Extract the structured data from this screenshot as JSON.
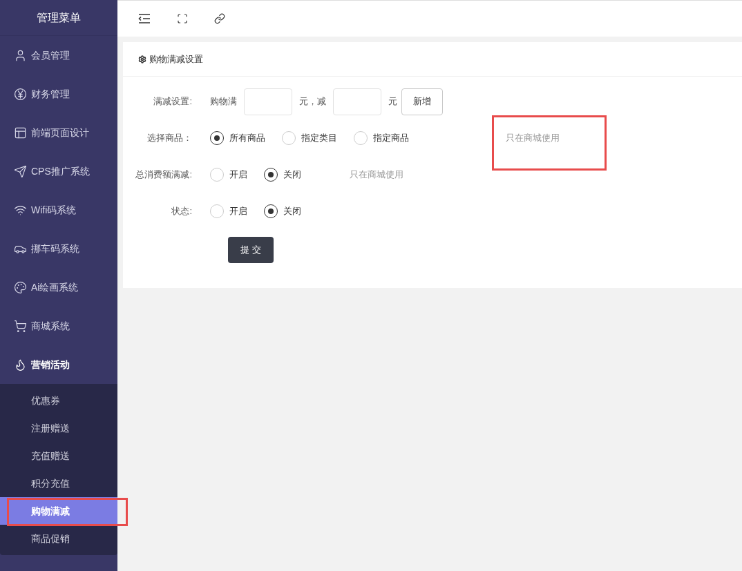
{
  "sidebar": {
    "title": "管理菜单",
    "items": [
      {
        "label": "会员管理",
        "expanded": false
      },
      {
        "label": "财务管理",
        "expanded": false
      },
      {
        "label": "前端页面设计",
        "expanded": false
      },
      {
        "label": "CPS推广系统",
        "expanded": false
      },
      {
        "label": "Wifi码系统",
        "expanded": false
      },
      {
        "label": "挪车码系统",
        "expanded": false
      },
      {
        "label": "Ai绘画系统",
        "expanded": false
      },
      {
        "label": "商城系统",
        "expanded": false
      },
      {
        "label": "营销活动",
        "expanded": true,
        "children": [
          {
            "label": "优惠券",
            "selected": false
          },
          {
            "label": "注册赠送",
            "selected": false
          },
          {
            "label": "充值赠送",
            "selected": false
          },
          {
            "label": "积分充值",
            "selected": false
          },
          {
            "label": "购物满减",
            "selected": true
          },
          {
            "label": "商品促销",
            "selected": false
          }
        ]
      }
    ]
  },
  "card": {
    "title": "购物满减设置",
    "rows": [
      {
        "kind": "amounts",
        "label": "满减设置:",
        "parts": [
          "购物满",
          "元，减",
          "元"
        ],
        "button": "新增"
      },
      {
        "kind": "radios",
        "label": "选择商品：",
        "options": [
          {
            "label": "所有商品",
            "selected": true
          },
          {
            "label": "指定类目",
            "selected": false
          },
          {
            "label": "指定商品",
            "selected": false
          }
        ],
        "note": "只在商城使用"
      },
      {
        "kind": "radios",
        "label": "总消费额满减:",
        "options": [
          {
            "label": "开启",
            "selected": false
          },
          {
            "label": "关闭",
            "selected": true
          }
        ],
        "note": "只在商城使用"
      },
      {
        "kind": "radios",
        "label": "状态:",
        "options": [
          {
            "label": "开启",
            "selected": false
          },
          {
            "label": "关闭",
            "selected": true
          }
        ]
      }
    ],
    "submit": "提 交"
  }
}
